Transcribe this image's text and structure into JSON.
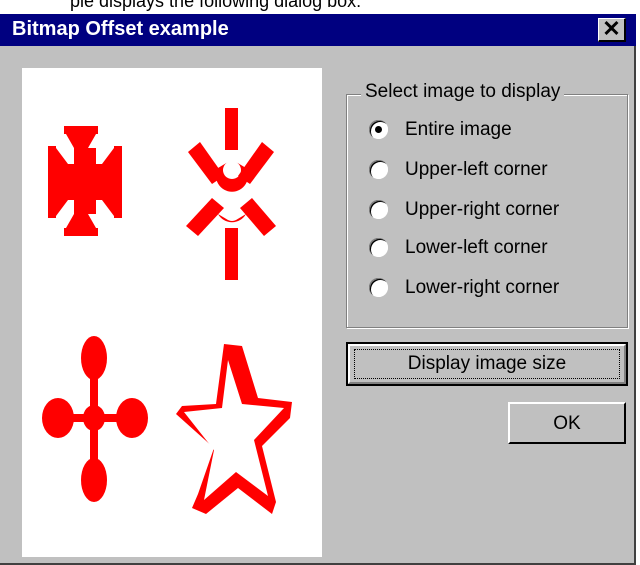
{
  "background_caption": "ple displays the following dialog box:",
  "window": {
    "title": "Bitmap Offset example",
    "close_glyph": "✕"
  },
  "image_panel": {
    "shapes": [
      "cross-pattee-icon",
      "spiked-asterisk-icon",
      "oval-cross-icon",
      "star-icon"
    ],
    "shape_color": "#ff0000"
  },
  "groupbox": {
    "legend": "Select image to display",
    "options": [
      {
        "label": "Entire image",
        "selected": true
      },
      {
        "label": "Upper-left corner",
        "selected": false
      },
      {
        "label": "Upper-right corner",
        "selected": false
      },
      {
        "label": "Lower-left corner",
        "selected": false
      },
      {
        "label": "Lower-right corner",
        "selected": false
      }
    ]
  },
  "buttons": {
    "display_size": "Display image size",
    "ok": "OK"
  },
  "colors": {
    "titlebar": "#000080",
    "face": "#c0c0c0"
  }
}
